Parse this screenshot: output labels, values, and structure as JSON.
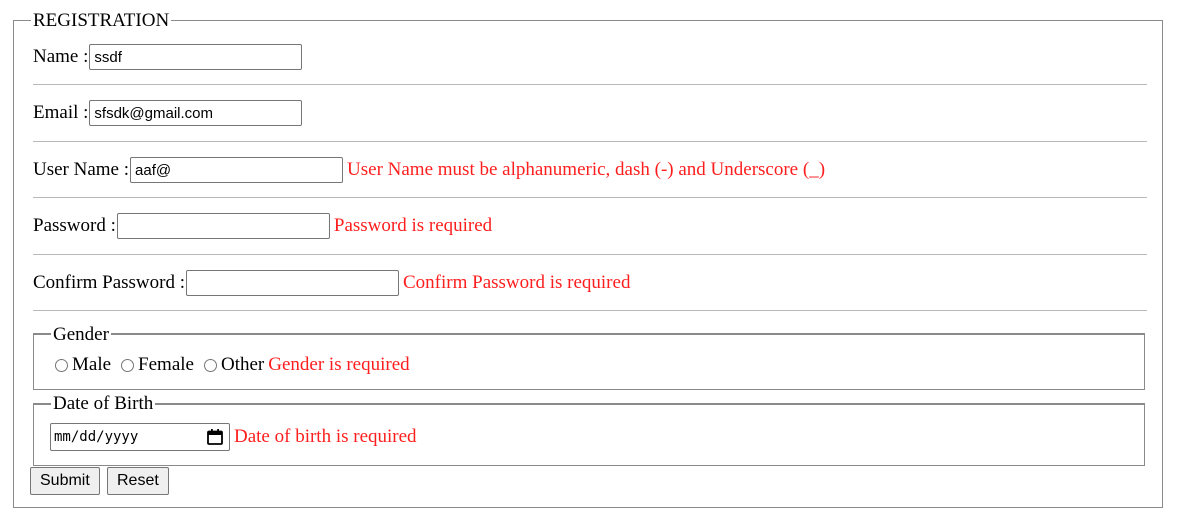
{
  "form": {
    "legend": "REGISTRATION",
    "name": {
      "label": "Name :",
      "value": "ssdf"
    },
    "email": {
      "label": "Email :",
      "value": "sfsdk@gmail.com"
    },
    "username": {
      "label": "User Name :",
      "value": "aaf@",
      "error": "User Name must be alphanumeric, dash (-) and Underscore (_)"
    },
    "password": {
      "label": "Password :",
      "value": "",
      "error": "Password is required"
    },
    "confirm_password": {
      "label": "Confirm Password :",
      "value": "",
      "error": "Confirm Password is required"
    },
    "gender": {
      "legend": "Gender",
      "options": [
        "Male",
        "Female",
        "Other"
      ],
      "error": "Gender is required"
    },
    "dob": {
      "legend": "Date of Birth",
      "placeholder": "mm/dd/yyyy",
      "error": "Date of birth is required"
    },
    "buttons": {
      "submit": "Submit",
      "reset": "Reset"
    }
  },
  "colors": {
    "error": "#ff1e1e",
    "border": "#8a8a8a",
    "button_bg": "#efefef"
  },
  "icons": {
    "date_picker": "calendar-icon",
    "radio": "radio-circle-icon"
  }
}
